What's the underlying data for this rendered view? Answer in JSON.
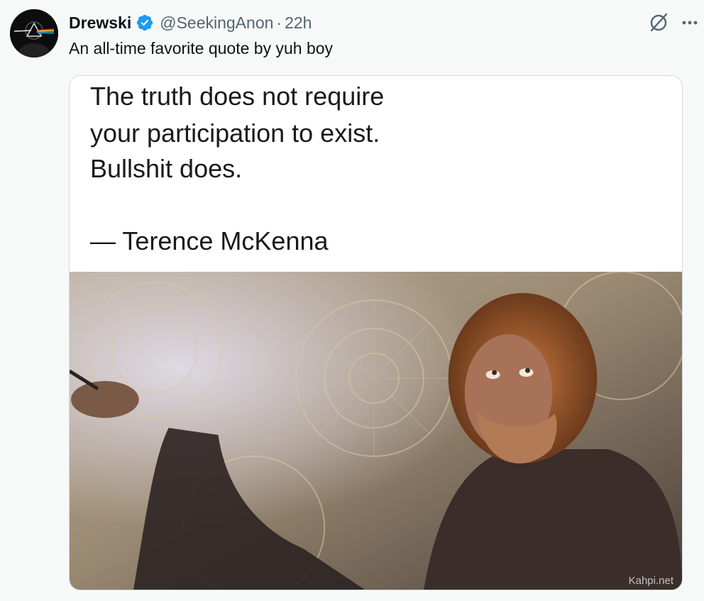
{
  "author": {
    "name": "Drewski",
    "handle": "@SeekingAnon",
    "separator": "·",
    "time": "22h"
  },
  "tweet": {
    "text": "An all-time favorite quote by yuh boy"
  },
  "media": {
    "quote_lines": [
      "The truth does not require",
      "your participation to exist.",
      "Bullshit does.",
      "— Terence McKenna"
    ],
    "watermark": "Kahpi.net"
  },
  "icons": {
    "verified": "verified-badge-icon",
    "grok": "grok-icon",
    "more": "more-options-icon"
  },
  "colors": {
    "verified_blue": "#1d9bf0",
    "secondary_text": "#536471",
    "background": "#f7f9f9"
  }
}
